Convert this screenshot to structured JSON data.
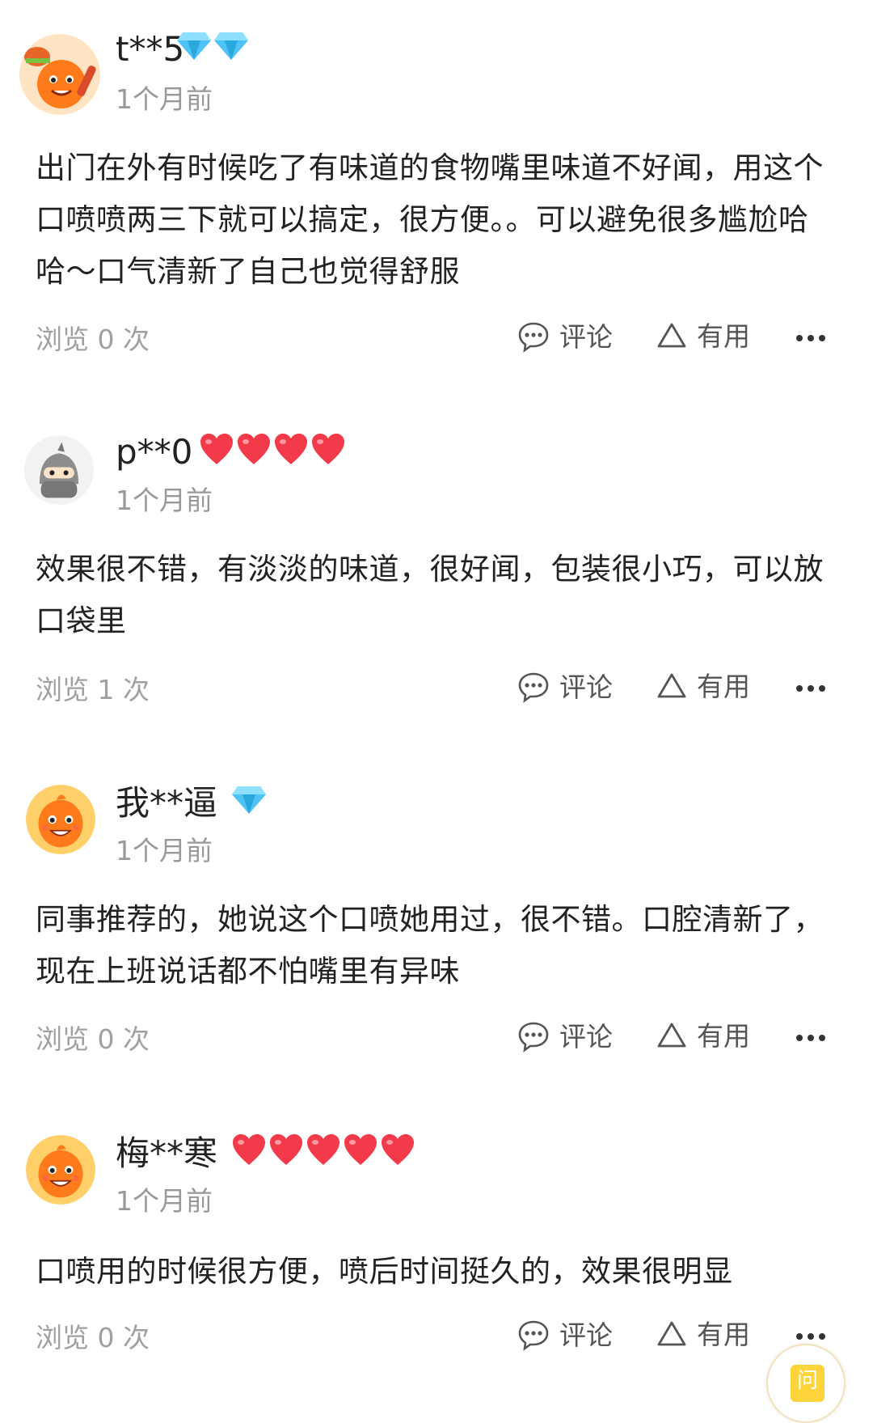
{
  "reviews": [
    {
      "username": "t**5",
      "badge": "diamond",
      "badge_count": 2,
      "time": "1个月前",
      "text": "出门在外有时候吃了有味道的食物嘴里味道不好闻，用这个口喷喷两三下就可以搞定，很方便。。可以避免很多尴尬哈哈～口气清新了自己也觉得舒服",
      "views": "浏览 0 次",
      "comment_label": "评论",
      "useful_label": "有用",
      "avatar": "orange-mascot-burger-avatar"
    },
    {
      "username": "p**0",
      "badge": "heart",
      "badge_count": 4,
      "time": "1个月前",
      "text": "效果很不错，有淡淡的味道，很好闻，包装很小巧，可以放口袋里",
      "views": "浏览 1 次",
      "comment_label": "评论",
      "useful_label": "有用",
      "avatar": "grey-ninja-avatar"
    },
    {
      "username": "我**逼",
      "badge": "diamond",
      "badge_count": 1,
      "time": "1个月前",
      "text": "同事推荐的，她说这个口喷她用过，很不错。口腔清新了，现在上班说话都不怕嘴里有异味",
      "views": "浏览 0 次",
      "comment_label": "评论",
      "useful_label": "有用",
      "avatar": "orange-mascot-avatar"
    },
    {
      "username": "梅**寒",
      "badge": "heart",
      "badge_count": 5,
      "time": "1个月前",
      "text": "口喷用的时候很方便，喷后时间挺久的，效果很明显",
      "views": "浏览 0 次",
      "comment_label": "评论",
      "useful_label": "有用",
      "avatar": "orange-mascot-avatar"
    }
  ],
  "float_button": {
    "label": "问"
  },
  "colors": {
    "text": "#222222",
    "muted": "#999999",
    "heart": "#f23a4a",
    "diamond": "#4fc3f7",
    "mascot": "#ff7a1a"
  }
}
